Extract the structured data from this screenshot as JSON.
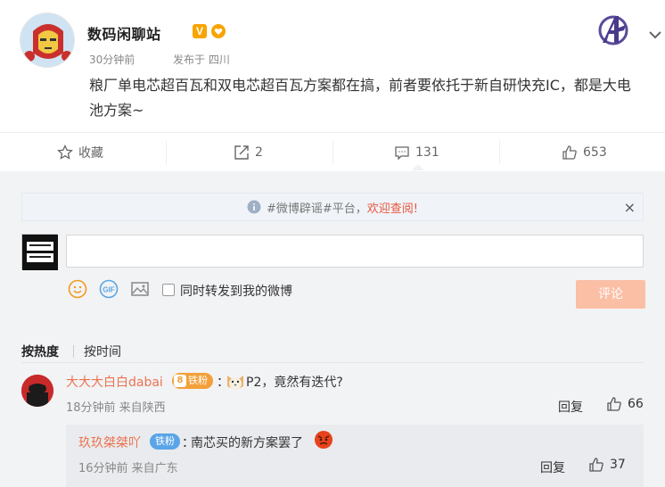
{
  "post": {
    "author": "数码闲聊站",
    "verified_badge": "V",
    "time": "30分钟前",
    "source": "发布于 四川",
    "text": "粮厂单电芯超百瓦和双电芯超百瓦方案都在搞，前者要依托于新自研快充IC，都是大电池方案~"
  },
  "actions": {
    "favorite": "收藏",
    "repost_count": "2",
    "comment_count": "131",
    "like_count": "653"
  },
  "notice": {
    "prefix": "#微博辟谣#平台，",
    "link": "欢迎查阅!",
    "close": "×"
  },
  "composer": {
    "input_value": "",
    "checkbox_label": "同时转发到我的微博",
    "submit_label": "评论",
    "gif_label": "GIF"
  },
  "sort": {
    "hot": "按热度",
    "time": "按时间"
  },
  "comment": {
    "user": "大大大白白dabai",
    "badge_level": "8",
    "badge_text": "铁粉",
    "colon": "：",
    "text": "P2，竟然有迭代?",
    "meta": "18分钟前 来自陕西",
    "reply_label": "回复",
    "likes": "66"
  },
  "sub_reply": {
    "user": "玖玖桀桀吖",
    "badge_text": "铁粉",
    "colon": "：",
    "text": "南芯买的新方案罢了",
    "meta": "16分钟前 来自广东",
    "reply_label": "回复",
    "likes": "37"
  },
  "colors": {
    "accent_orange": "#eb7350",
    "submit_disabled": "#fbbfa5",
    "fan_badge_blue": "#5aa4e8",
    "fan_badge_orange": "#f3a03a"
  }
}
